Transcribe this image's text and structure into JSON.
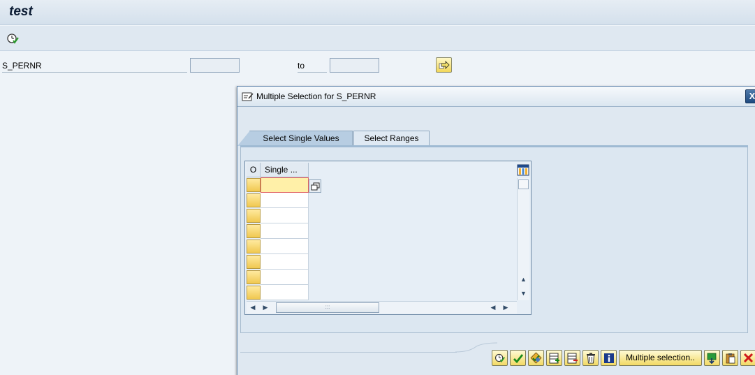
{
  "window": {
    "title": "test"
  },
  "icons": {
    "execute": "clock-check-icon",
    "multiple_selection": "arrow-right-icon",
    "dialog": "form-icon",
    "close": "close-icon"
  },
  "selection": {
    "field_label": "S_PERNR",
    "low_value": "",
    "to_label": "to",
    "high_value": ""
  },
  "dialog": {
    "title": "Multiple Selection for S_PERNR",
    "close_label": "X",
    "tabs": [
      {
        "label": "Select Single Values",
        "active": true
      },
      {
        "label": "Select Ranges",
        "active": false
      }
    ],
    "table": {
      "headers": [
        "O",
        "Single ..."
      ],
      "rows": [
        "",
        "",
        "",
        "",
        "",
        "",
        "",
        ""
      ],
      "hscroll_grip": ":::"
    },
    "footer": {
      "multiple_selection_label": "Multiple selection.."
    }
  },
  "colors": {
    "button_yellow": "#f2d964",
    "dialog_border": "#5d82ab",
    "tab_active": "#b7cde2",
    "focus_cell": "#fff0a8"
  }
}
